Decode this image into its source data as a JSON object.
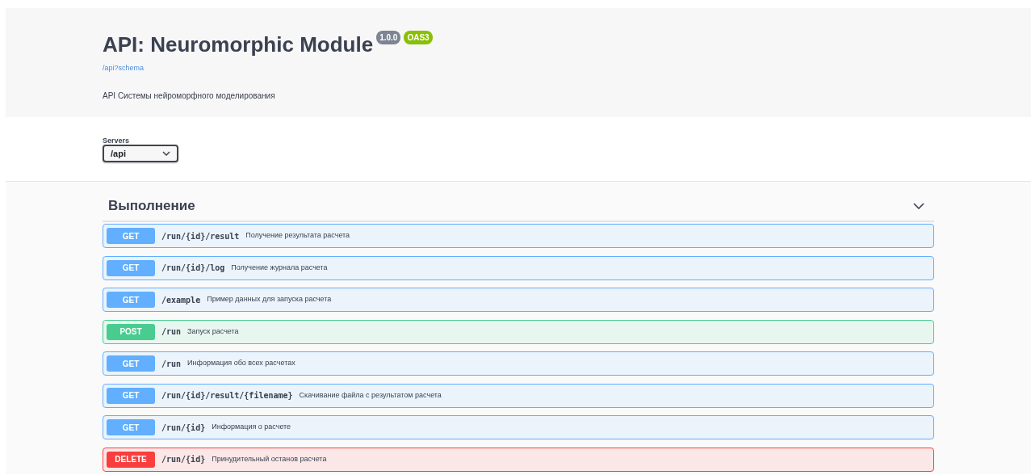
{
  "info": {
    "title": "API: Neuromorphic Module",
    "version": "1.0.0",
    "spec": "OAS3",
    "schema_link": "/api?schema",
    "description": "API Системы нейроморфного моделирования"
  },
  "servers": {
    "label": "Servers",
    "value": "/api"
  },
  "tag": {
    "name": "Выполнение",
    "expanded": true,
    "operations": [
      {
        "method": "GET",
        "path": "/run/{id}/result",
        "summary": "Получение результата расчета"
      },
      {
        "method": "GET",
        "path": "/run/{id}/log",
        "summary": "Получение журнала расчета"
      },
      {
        "method": "GET",
        "path": "/example",
        "summary": "Пример данных для запуска расчета"
      },
      {
        "method": "POST",
        "path": "/run",
        "summary": "Запуск расчета"
      },
      {
        "method": "GET",
        "path": "/run",
        "summary": "Информация обо всех расчетах"
      },
      {
        "method": "GET",
        "path": "/run/{id}/result/{filename}",
        "summary": "Скачивание файла с результатом расчета"
      },
      {
        "method": "GET",
        "path": "/run/{id}",
        "summary": "Информация о расчете"
      },
      {
        "method": "DELETE",
        "path": "/run/{id}",
        "summary": "Принудительный останов расчета"
      }
    ]
  }
}
